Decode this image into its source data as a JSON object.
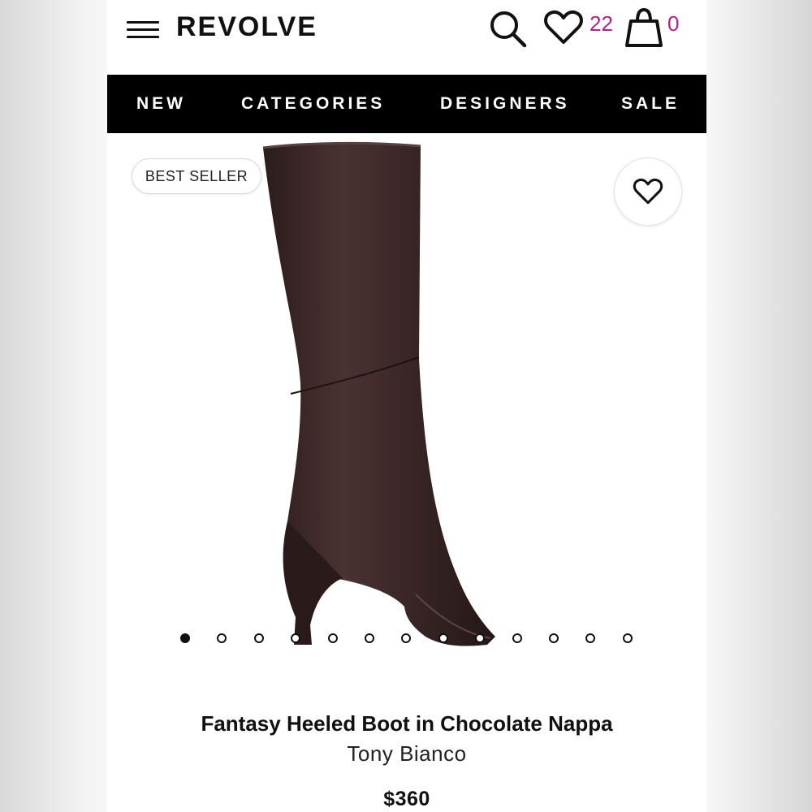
{
  "header": {
    "logo": "REVOLVE",
    "wishlist_count": "22",
    "bag_count": "0"
  },
  "nav": {
    "items": [
      "NEW",
      "CATEGORIES",
      "DESIGNERS",
      "SALE"
    ]
  },
  "product": {
    "badge": "BEST SELLER",
    "title": "Fantasy Heeled Boot in Chocolate Nappa",
    "brand": "Tony Bianco",
    "price": "$360",
    "image_count": 13,
    "active_image_index": 0,
    "boot_color": "#3a2626"
  },
  "colors": {
    "accent": "#b0237e",
    "nav_bg": "#000000"
  },
  "icons": [
    "menu-icon",
    "search-icon",
    "heart-icon",
    "shopping-bag-icon"
  ]
}
